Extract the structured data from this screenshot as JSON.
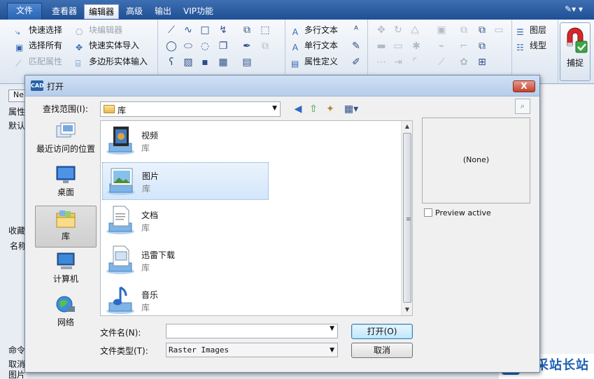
{
  "menubar": {
    "file": "文件",
    "items": [
      "查看器",
      "编辑器",
      "高级",
      "输出",
      "VIP功能"
    ]
  },
  "ribbon": {
    "left_buttons": [
      {
        "label": "快速选择",
        "enabled": true
      },
      {
        "label": "块编辑器",
        "enabled": false
      },
      {
        "label": "选择所有",
        "enabled": true
      },
      {
        "label": "快速实体导入",
        "enabled": true
      },
      {
        "label": "匹配属性",
        "enabled": false
      },
      {
        "label": "多边形实体输入",
        "enabled": true
      }
    ],
    "text_buttons": [
      "多行文本",
      "单行文本",
      "属性定义"
    ],
    "layer_buttons": [
      "图层",
      "线型"
    ],
    "capture_label": "捕捉"
  },
  "background": {
    "tab_ne": "Ne",
    "left_labels": [
      "属性",
      "默认",
      "收藏",
      "名称",
      "命令",
      "取消",
      "图片"
    ]
  },
  "dialog": {
    "title": "打开",
    "app_icon_text": "CAD",
    "close_glyph": "X",
    "lookin_label": "查找范围(I):",
    "lookin_value": "库",
    "places": [
      {
        "label": "最近访问的位置",
        "icon": "recent-places-icon",
        "selected": false
      },
      {
        "label": "桌面",
        "icon": "desktop-icon",
        "selected": false
      },
      {
        "label": "库",
        "icon": "libraries-icon",
        "selected": true
      },
      {
        "label": "计算机",
        "icon": "computer-icon",
        "selected": false
      },
      {
        "label": "网络",
        "icon": "network-icon",
        "selected": false
      }
    ],
    "files": [
      {
        "name": "视频",
        "type": "库",
        "icon": "videos-library-icon",
        "selected": false
      },
      {
        "name": "图片",
        "type": "库",
        "icon": "pictures-library-icon",
        "selected": true
      },
      {
        "name": "文档",
        "type": "库",
        "icon": "documents-library-icon",
        "selected": false
      },
      {
        "name": "迅雷下载",
        "type": "库",
        "icon": "downloads-library-icon",
        "selected": false
      },
      {
        "name": "音乐",
        "type": "库",
        "icon": "music-library-icon",
        "selected": false
      }
    ],
    "preview_text": "(None)",
    "preview_active_label": "Preview active",
    "preview_active_checked": false,
    "filename_label": "文件名(N):",
    "filename_value": "",
    "filetype_label": "文件类型(T):",
    "filetype_value": "Raster Images",
    "open_button": "打开(O)",
    "cancel_button": "取消"
  },
  "watermark": {
    "text": "易采站长站"
  }
}
